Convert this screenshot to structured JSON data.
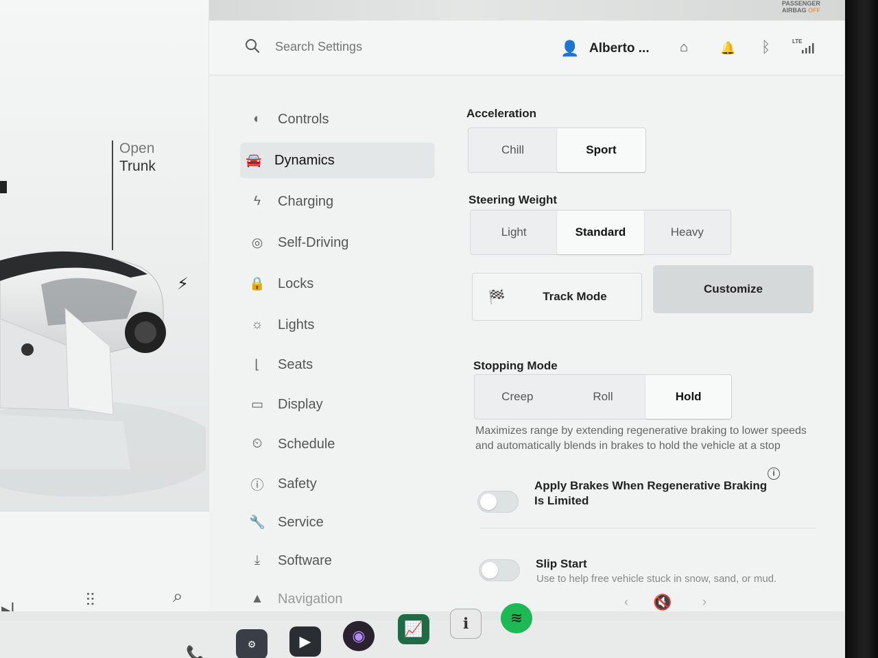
{
  "status": {
    "airbag_line1": "PASSENGER",
    "airbag_line2": "AIRBAG",
    "airbag_state": "OFF",
    "network": "LTE"
  },
  "car_panel": {
    "open_label": "Open",
    "trunk_label": "Trunk"
  },
  "header": {
    "search_placeholder": "Search Settings",
    "user_name": "Alberto ..."
  },
  "sidebar": {
    "items": [
      {
        "label": "Controls",
        "icon": "toggle-icon"
      },
      {
        "label": "Dynamics",
        "icon": "car-icon",
        "active": true
      },
      {
        "label": "Charging",
        "icon": "bolt-icon"
      },
      {
        "label": "Self-Driving",
        "icon": "steering-wheel-icon"
      },
      {
        "label": "Locks",
        "icon": "lock-icon"
      },
      {
        "label": "Lights",
        "icon": "sun-icon"
      },
      {
        "label": "Seats",
        "icon": "seat-icon"
      },
      {
        "label": "Display",
        "icon": "display-icon"
      },
      {
        "label": "Schedule",
        "icon": "clock-icon"
      },
      {
        "label": "Safety",
        "icon": "alert-icon"
      },
      {
        "label": "Service",
        "icon": "wrench-icon"
      },
      {
        "label": "Software",
        "icon": "download-icon"
      },
      {
        "label": "Navigation",
        "icon": "navigation-icon"
      }
    ]
  },
  "dynamics": {
    "acceleration": {
      "label": "Acceleration",
      "options": [
        "Chill",
        "Sport"
      ],
      "selected": "Sport"
    },
    "steering_weight": {
      "label": "Steering Weight",
      "options": [
        "Light",
        "Standard",
        "Heavy"
      ],
      "selected": "Standard"
    },
    "track_mode_label": "Track Mode",
    "customize_label": "Customize",
    "stopping_mode": {
      "label": "Stopping Mode",
      "options": [
        "Creep",
        "Roll",
        "Hold"
      ],
      "selected": "Hold",
      "description": "Maximizes range by extending regenerative braking to lower speeds and automatically blends in brakes to hold the vehicle at a stop"
    },
    "apply_brakes": {
      "label": "Apply Brakes When Regenerative Braking Is Limited",
      "enabled": false
    },
    "slip_start": {
      "label": "Slip Start",
      "description": "Use to help free vehicle stuck in snow, sand, or mud.",
      "enabled": false
    }
  },
  "colors": {
    "screen_bg": "#eceff0",
    "selected_segment": "#f8f9f9",
    "customize_bg": "#d6d9da",
    "spotify_green": "#1db954"
  }
}
